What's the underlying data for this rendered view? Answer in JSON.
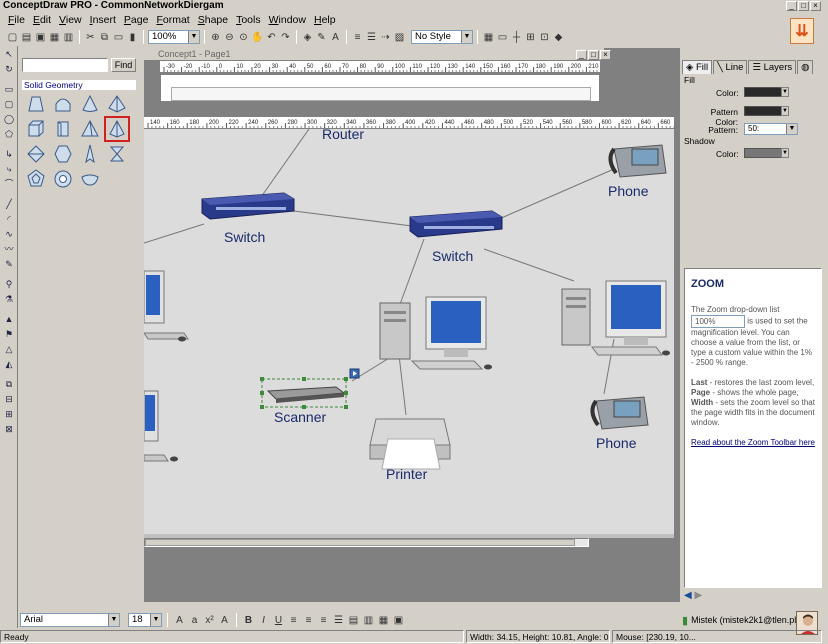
{
  "app": {
    "title": "ConceptDraw PRO - CommonNetworkDiergam",
    "window_controls": [
      "_",
      "□",
      "×"
    ]
  },
  "menu": [
    "File",
    "Edit",
    "View",
    "Insert",
    "Page",
    "Format",
    "Shape",
    "Tools",
    "Window",
    "Help"
  ],
  "toolbar": {
    "zoom_value": "100%",
    "style_value": "No Style"
  },
  "library": {
    "find_placeholder": "",
    "find_label": "Find",
    "title": "Solid Geometry"
  },
  "document": {
    "title": "Concept1 - Page1",
    "ruler_top": [
      "-30",
      "-20",
      "-10",
      "0",
      "10",
      "20",
      "30",
      "40",
      "50",
      "60",
      "70",
      "80",
      "90",
      "100",
      "110",
      "120",
      "130",
      "140",
      "150",
      "160",
      "170",
      "180",
      "190",
      "200",
      "210"
    ],
    "ruler_main": [
      "140",
      "160",
      "180",
      "200",
      "220",
      "240",
      "260",
      "280",
      "300",
      "320",
      "340",
      "360",
      "380",
      "400",
      "420",
      "440",
      "460",
      "480",
      "500",
      "520",
      "540",
      "560",
      "580",
      "600",
      "620",
      "640",
      "660"
    ]
  },
  "diagram": {
    "labels": {
      "router": "Router",
      "phone1": "Phone",
      "switch1": "Switch",
      "switch2": "Switch",
      "scanner": "Scanner",
      "printer": "Printer",
      "phone2": "Phone"
    }
  },
  "properties": {
    "tabs": [
      "Fill",
      "Line",
      "Layers",
      ""
    ],
    "fill_section": "Fill",
    "color_label": "Color:",
    "pattern_color_label": "Pattern Color:",
    "pattern_label": "Pattern:",
    "pattern_value": "50:",
    "shadow_section": "Shadow",
    "shadow_color_label": "Color:",
    "colors": {
      "fill_color": "#2a2a2a",
      "pattern_color": "#2a2a2a",
      "shadow_color": "#777777"
    }
  },
  "help": {
    "title": "ZOOM",
    "intro_a": "The Zoom drop-down list",
    "combo_value": "100%",
    "intro_b": "is used to set the magnification level. You can choose a value from the list, or type a custom value within the 1% - 2500 % range.",
    "last_term": "Last",
    "last_text": " - restores the last zoom level,",
    "page_term": "Page",
    "page_text": " - shows the whole page,",
    "width_term": "Width",
    "width_text": " - sets the zoom level so that the page width fits in the document window.",
    "link_text": "Read about the Zoom Toolbar here"
  },
  "formatbar": {
    "font_value": "Arial",
    "size_value": "18"
  },
  "user": {
    "name": "Mistek (mistek2k1@tlen.pl)"
  },
  "status": {
    "ready": "Ready",
    "dims": "Width: 34.15, Height: 10.81, Angle: 0°",
    "mouse": "Mouse: [230.19, 10..."
  }
}
